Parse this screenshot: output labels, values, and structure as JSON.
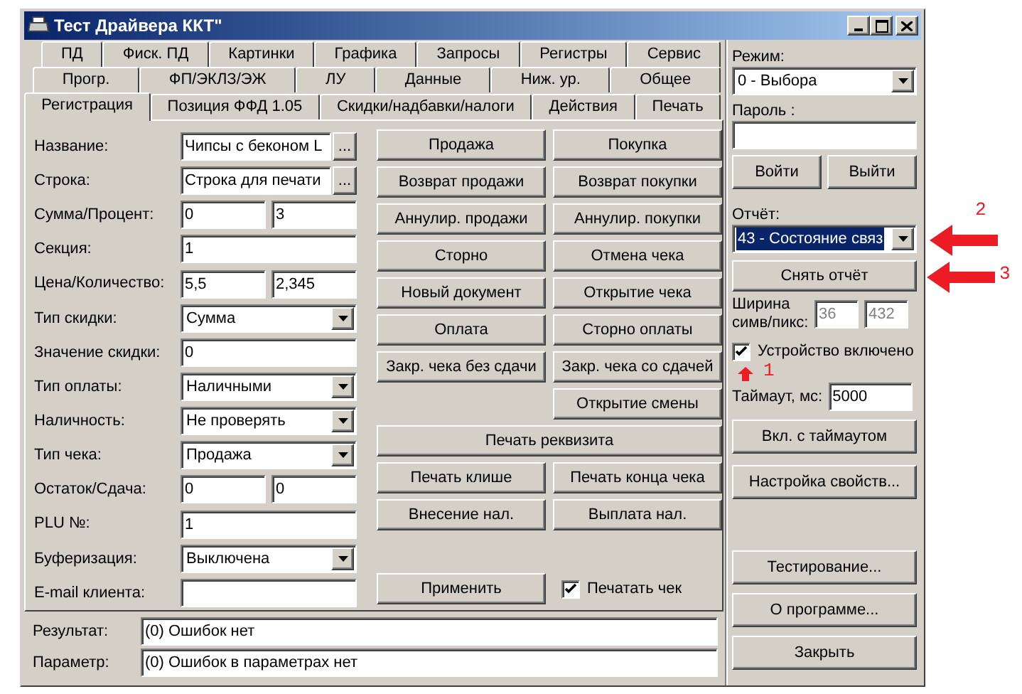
{
  "window": {
    "title": "Тест Драйвера ККТ\""
  },
  "tab_rows": [
    [
      {
        "label": "ПД",
        "selected": false
      },
      {
        "label": "Фиск. ПД",
        "selected": false
      },
      {
        "label": "Картинки",
        "selected": false
      },
      {
        "label": "Графика",
        "selected": false
      },
      {
        "label": "Запросы",
        "selected": false
      },
      {
        "label": "Регистры",
        "selected": false
      },
      {
        "label": "Сервис",
        "selected": false
      }
    ],
    [
      {
        "label": "Прогр.",
        "selected": false
      },
      {
        "label": "ФП/ЭКЛЗ/ЭЖ",
        "selected": false
      },
      {
        "label": "ЛУ",
        "selected": false
      },
      {
        "label": "Данные",
        "selected": false
      },
      {
        "label": "Ниж. ур.",
        "selected": false
      },
      {
        "label": "Общее",
        "selected": false
      }
    ],
    [
      {
        "label": "Регистрация",
        "selected": true
      },
      {
        "label": "Позиция ФФД 1.05",
        "selected": false
      },
      {
        "label": "Скидки/надбавки/налоги",
        "selected": false
      },
      {
        "label": "Действия",
        "selected": false
      },
      {
        "label": "Печать",
        "selected": false
      }
    ]
  ],
  "form": [
    {
      "kind": "text_button",
      "label": "Название:",
      "values": [
        "Чипсы с беконом L"
      ],
      "button": "..."
    },
    {
      "kind": "text_button",
      "label": "Строка:",
      "values": [
        "Строка для печати"
      ],
      "button": "..."
    },
    {
      "kind": "pair",
      "label": "Сумма/Процент:",
      "values": [
        "0",
        "3"
      ]
    },
    {
      "kind": "text",
      "label": "Секция:",
      "values": [
        "1"
      ]
    },
    {
      "kind": "pair",
      "label": "Цена/Количество:",
      "values": [
        "5,5",
        "2,345"
      ]
    },
    {
      "kind": "dropdown",
      "label": "Тип скидки:",
      "values": [
        "Сумма"
      ]
    },
    {
      "kind": "text",
      "label": "Значение скидки:",
      "values": [
        "0"
      ]
    },
    {
      "kind": "dropdown",
      "label": "Тип оплаты:",
      "values": [
        "Наличными"
      ]
    },
    {
      "kind": "dropdown",
      "label": "Наличность:",
      "values": [
        "Не проверять"
      ]
    },
    {
      "kind": "dropdown",
      "label": "Тип чека:",
      "values": [
        "Продажа"
      ]
    },
    {
      "kind": "pair",
      "label": "Остаток/Сдача:",
      "values": [
        "0",
        "0"
      ]
    },
    {
      "kind": "text",
      "label": "PLU №:",
      "values": [
        "1"
      ]
    },
    {
      "kind": "dropdown",
      "label": "Буферизация:",
      "values": [
        "Выключена"
      ]
    },
    {
      "kind": "text",
      "label": "E-mail клиента:"
    }
  ],
  "action_rows": [
    {
      "kind": "pair",
      "left": "Продажа",
      "right": "Покупка"
    },
    {
      "kind": "pair",
      "left": "Возврат продажи",
      "right": "Возврат покупки"
    },
    {
      "kind": "pair",
      "left": "Аннулир. продажи",
      "right": "Аннулир. покупки"
    },
    {
      "kind": "pair",
      "left": "Сторно",
      "right": "Отмена чека"
    },
    {
      "kind": "pair",
      "left": "Новый документ",
      "right": "Открытие чека"
    },
    {
      "kind": "pair",
      "left": "Оплата",
      "right": "Сторно оплаты"
    },
    {
      "kind": "pair",
      "left": "Закр. чека без сдачи",
      "right": "Закр. чека со сдачей"
    },
    {
      "kind": "pair",
      "right": "Открытие смены"
    },
    {
      "kind": "wide",
      "left": "Печать реквизита"
    },
    {
      "kind": "pair",
      "left": "Печать клише",
      "right": "Печать конца чека"
    },
    {
      "kind": "pair",
      "left": "Внесение нал.",
      "right": "Выплата нал."
    },
    {
      "kind": "blank"
    },
    {
      "kind": "apply",
      "left": "Применить",
      "checkbox": {
        "label": "Печатать чек",
        "checked": true
      }
    }
  ],
  "status": [
    {
      "label": "Результат:",
      "value": "(0) Ошибок нет"
    },
    {
      "label": "Параметр:",
      "value": "(0) Ошибок в параметрах нет"
    }
  ],
  "side": {
    "mode": {
      "label": "Режим:",
      "value": "0 - Выбора"
    },
    "password": {
      "label": "Пароль :"
    },
    "login_buttons": [
      "Войти",
      "Выйти"
    ],
    "report": {
      "label": "Отчёт:",
      "value": "43 - Состояние связ",
      "highlighted": true
    },
    "report_button": "Снять отчёт",
    "width": {
      "label": "Ширина симв/пикс:",
      "values": [
        "36",
        "432"
      ],
      "disabled": true
    },
    "device_enabled": {
      "label": "Устройство включено",
      "checked": true
    },
    "timeout": {
      "label": "Таймаут, мс:",
      "value": "5000"
    },
    "buttons": [
      "Вкл. с таймаутом",
      "Настройка свойств..."
    ],
    "bottom_buttons": [
      "Тестирование...",
      "О программе...",
      "Закрыть"
    ]
  },
  "annotations": [
    {
      "kind": "left_arrow",
      "label": "2"
    },
    {
      "kind": "left_arrow",
      "label": "3"
    },
    {
      "kind": "up_arrow",
      "label": "1"
    }
  ]
}
